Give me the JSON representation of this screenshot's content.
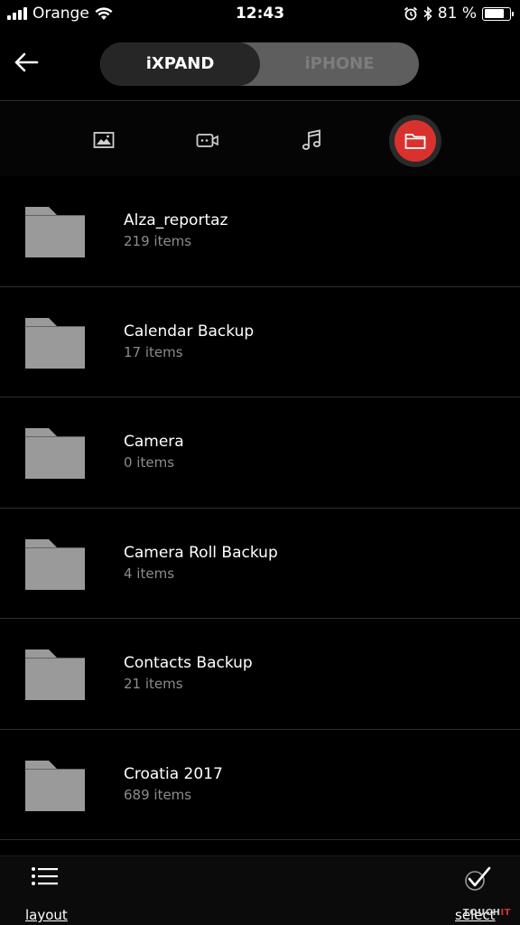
{
  "status_bar": {
    "carrier": "Orange",
    "time": "12:43",
    "battery_percent": "81 %",
    "battery_level": 0.81
  },
  "header": {
    "back_icon": "arrow-left-icon",
    "tabs": [
      {
        "label": "iXPAND",
        "active": true
      },
      {
        "label": "iPHONE",
        "active": false
      }
    ]
  },
  "filters": [
    {
      "icon": "image-icon",
      "active": false
    },
    {
      "icon": "video-icon",
      "active": false
    },
    {
      "icon": "music-icon",
      "active": false
    },
    {
      "icon": "folder-icon",
      "active": true
    }
  ],
  "folders": [
    {
      "name": "Alza_reportaz",
      "count": "219 items"
    },
    {
      "name": "Calendar Backup",
      "count": "17 items"
    },
    {
      "name": "Camera",
      "count": "0 items"
    },
    {
      "name": "Camera Roll Backup",
      "count": "4 items"
    },
    {
      "name": "Contacts Backup",
      "count": "21 items"
    },
    {
      "name": "Croatia 2017",
      "count": "689 items"
    }
  ],
  "bottom_bar": {
    "layout_label": "layout",
    "select_label": "select"
  },
  "watermark": {
    "main": "TOUCH",
    "accent": "IT"
  },
  "colors": {
    "accent": "#d9322e",
    "folder": "#9a9a9a",
    "background": "#000000"
  }
}
